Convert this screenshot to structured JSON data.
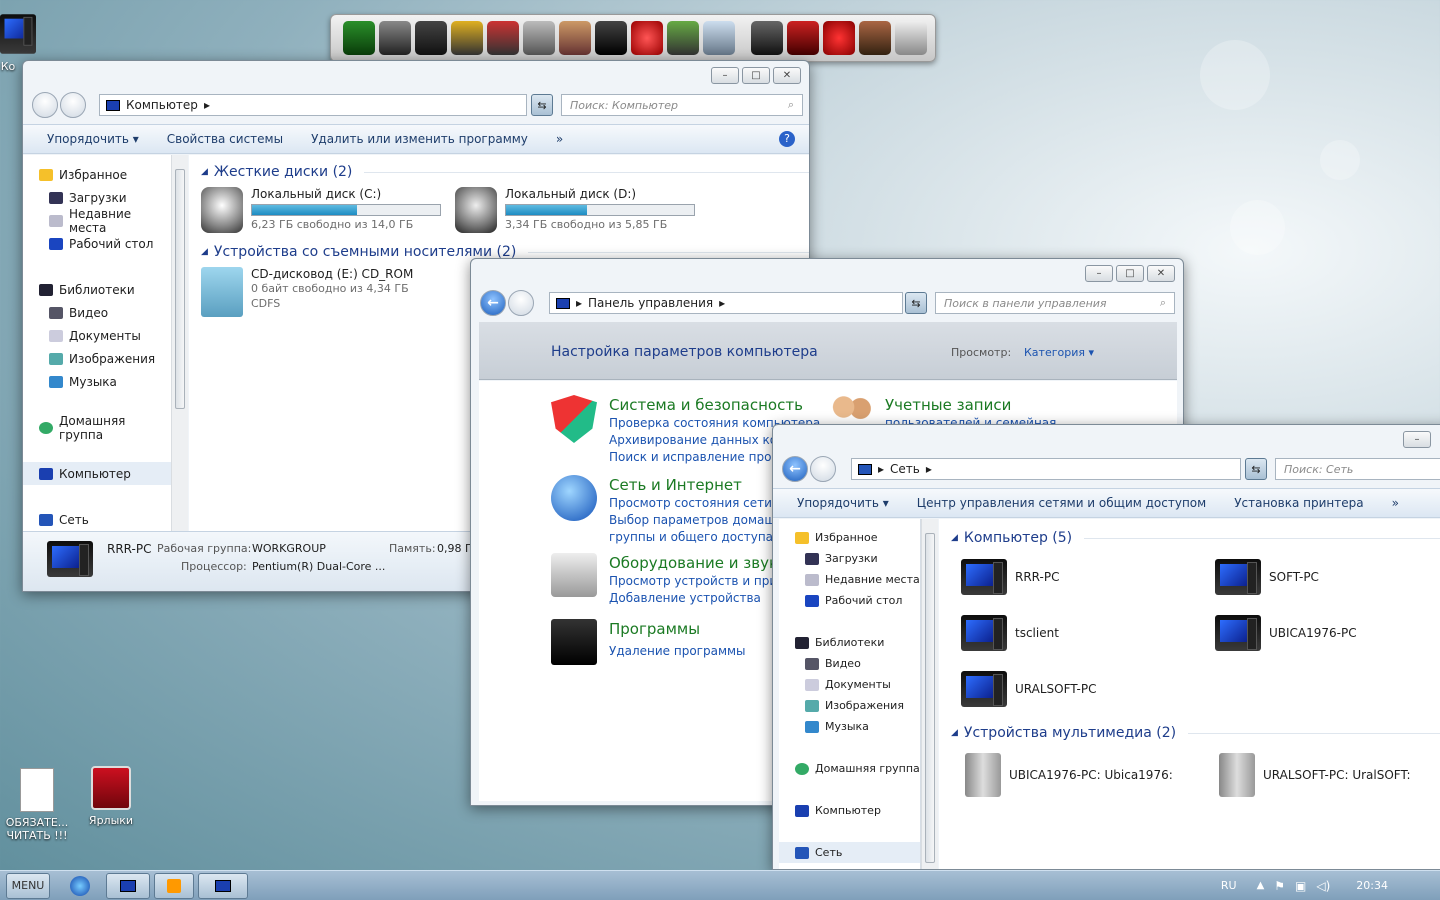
{
  "desktop": {
    "icons": [
      {
        "label": "Ко"
      },
      {
        "label": "ОБЯЗАТЕ... ЧИТАТЬ !!!"
      },
      {
        "label": "Ярлыки"
      }
    ]
  },
  "computer_window": {
    "address": "Компьютер",
    "search_placeholder": "Поиск: Компьютер",
    "toolbar": [
      "Упорядочить ▾",
      "Свойства системы",
      "Удалить или изменить программу",
      "»"
    ],
    "nav": [
      "Избранное",
      "Загрузки",
      "Недавние места",
      "Рабочий стол",
      "Библиотеки",
      "Видео",
      "Документы",
      "Изображения",
      "Музыка",
      "Домашняя группа",
      "Компьютер",
      "Сеть"
    ],
    "hdd_group": "Жесткие диски (2)",
    "drives": [
      {
        "name": "Локальный диск (C:)",
        "free": "6,23 ГБ свободно из 14,0 ГБ",
        "fill": 0.56
      },
      {
        "name": "Локальный диск (D:)",
        "free": "3,34 ГБ свободно из 5,85 ГБ",
        "fill": 0.43
      }
    ],
    "removable_group": "Устройства со съемными носителями (2)",
    "cd": {
      "name": "CD-дисковод (E:) CD_ROM",
      "free": "0 байт свободно из 4,34 ГБ",
      "fs": "CDFS"
    },
    "details": {
      "name": "RRR-PC",
      "wg_label": "Рабочая группа:",
      "wg": "WORKGROUP",
      "mem_label": "Память:",
      "mem": "0,98 ГБ",
      "cpu_label": "Процессор:",
      "cpu": "Pentium(R) Dual-Core ..."
    }
  },
  "control_panel_window": {
    "address": "Панель управления",
    "search_placeholder": "Поиск в панели управления",
    "header": "Настройка параметров компьютера",
    "view_label": "Просмотр:",
    "view_value": "Категория ▾",
    "categories": [
      {
        "title": "Система и безопасность",
        "links": [
          "Проверка состояния компьютера",
          "Архивирование данных компьютера",
          "Поиск и исправление проблем"
        ]
      },
      {
        "title": "Сеть и Интернет",
        "links": [
          "Просмотр состояния сети и задач",
          "Выбор параметров домашней",
          "группы и общего доступа к данным"
        ]
      },
      {
        "title": "Оборудование и звук",
        "links": [
          "Просмотр устройств и принтеров",
          "Добавление устройства"
        ]
      },
      {
        "title": "Программы",
        "links": [
          "Удаление программы"
        ]
      }
    ],
    "accounts": {
      "title": "Учетные записи",
      "link": "пользователей и семейная"
    }
  },
  "network_window": {
    "address": "Сеть",
    "search_placeholder": "Поиск: Сеть",
    "toolbar": [
      "Упорядочить ▾",
      "Центр управления сетями и общим доступом",
      "Установка принтера",
      "»"
    ],
    "nav": [
      "Избранное",
      "Загрузки",
      "Недавние места",
      "Рабочий стол",
      "Библиотеки",
      "Видео",
      "Документы",
      "Изображения",
      "Музыка",
      "Домашняя группа",
      "Компьютер",
      "Сеть"
    ],
    "computers_group": "Компьютер (5)",
    "computers": [
      "RRR-PC",
      "SOFT-PC",
      "tsclient",
      "UBICA1976-PC",
      "URALSOFT-PC"
    ],
    "media_group": "Устройства мультимедиа (2)",
    "media": [
      "UBICA1976-PC: Ubica1976:",
      "URALSOFT-PC: UralSOFT:"
    ]
  },
  "taskbar": {
    "menu": "MENU",
    "lang": "RU",
    "time": "20:34"
  }
}
